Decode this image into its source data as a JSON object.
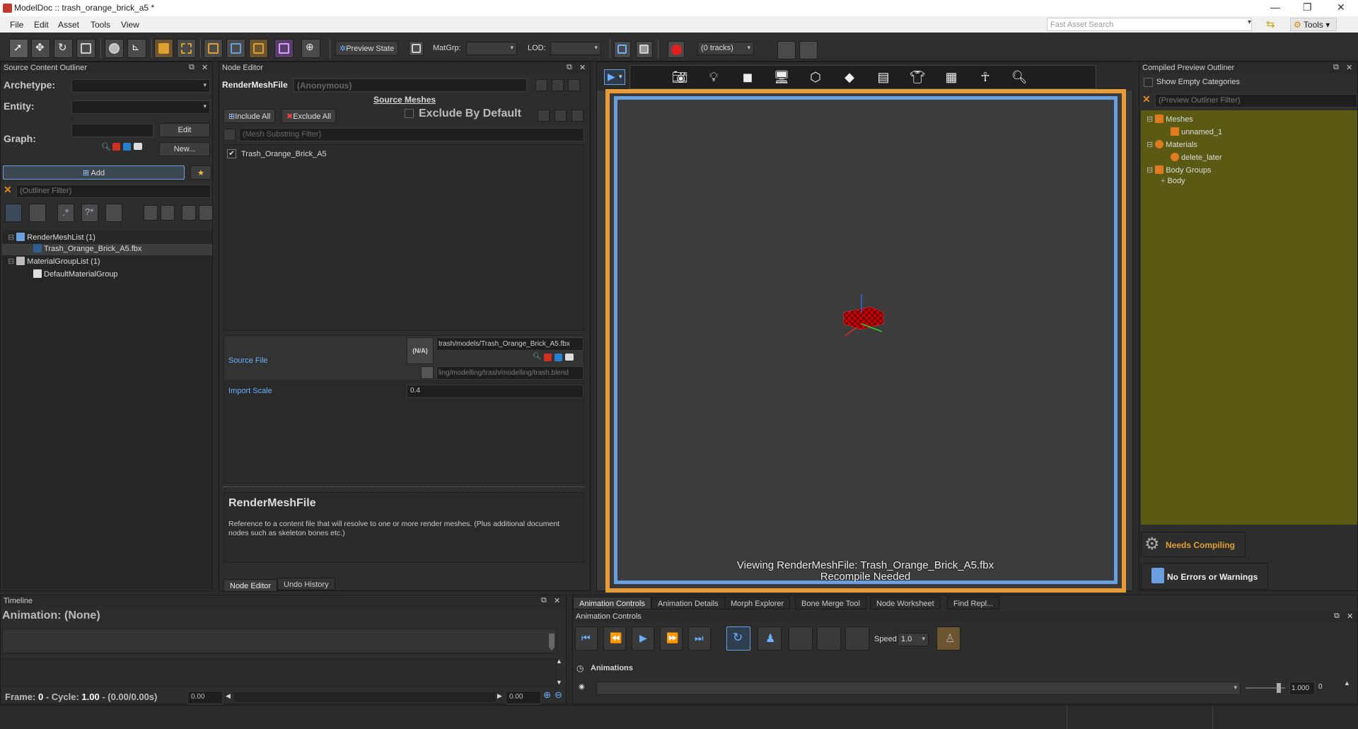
{
  "window": {
    "title": "ModelDoc :: trash_orange_brick_a5 *"
  },
  "menu": [
    "File",
    "Edit",
    "Asset",
    "Tools",
    "View"
  ],
  "fast_search": {
    "placeholder": "Fast Asset Search"
  },
  "tools_label": "Tools",
  "toolbar": {
    "preview_state": "Preview State",
    "matgrp_label": "MatGrp:",
    "matgrp_value": "",
    "lod_label": "LOD:",
    "lod_value": "",
    "tracks_value": "(0 tracks)"
  },
  "outliner": {
    "title": "Source Content Outliner",
    "archetype_label": "Archetype:",
    "entity_label": "Entity:",
    "graph_label": "Graph:",
    "edit_label": "Edit",
    "new_label": "New...",
    "add_label": "Add",
    "filter_placeholder": "(Outliner Filter)",
    "tree": [
      {
        "label": "RenderMeshList (1)"
      },
      {
        "label": "Trash_Orange_Brick_A5.fbx"
      },
      {
        "label": "MaterialGroupList (1)"
      },
      {
        "label": "DefaultMaterialGroup"
      }
    ]
  },
  "node_editor": {
    "title": "Node Editor",
    "node_type": "RenderMeshFile",
    "node_name": "(Anonymous)",
    "source_meshes": "Source Meshes",
    "include_all": "Include All",
    "exclude_all": "Exclude All",
    "exclude_by_default": "Exclude By Default",
    "mesh_filter_placeholder": "(Mesh Substring Filter)",
    "mesh_item": "Trash_Orange_Brick_A5",
    "source_file_label": "Source File",
    "na_label": "(N/A)",
    "source_file_value": "trash/models/Trash_Orange_Brick_A5.fbx",
    "blend_file_value": "ling/modelling/trash/modelling/trash.blend",
    "import_scale_label": "Import Scale",
    "import_scale_value": "0.4",
    "help_title": "RenderMeshFile",
    "help_text": "Reference to a content file that will resolve to one or more render meshes. (Plus additional document nodes such as skeleton bones etc.)",
    "tabs": [
      "Node Editor",
      "Undo History"
    ]
  },
  "viewport": {
    "status_line1": "Viewing RenderMeshFile: Trash_Orange_Brick_A5.fbx",
    "status_line2": "Recompile Needed"
  },
  "compiled_outliner": {
    "title": "Compiled Preview Outliner",
    "show_empty": "Show Empty Categories",
    "filter_placeholder": "(Preview Outliner Filter)",
    "tree": [
      {
        "label": "Meshes"
      },
      {
        "label": "unnamed_1"
      },
      {
        "label": "Materials"
      },
      {
        "label": "delete_later"
      },
      {
        "label": "Body Groups"
      },
      {
        "label": "Body"
      }
    ],
    "needs_compiling": "Needs Compiling",
    "no_errors": "No Errors or Warnings"
  },
  "timeline": {
    "title": "Timeline",
    "animation": "Animation: (None)",
    "frame_prefix": "Frame: ",
    "frame_value": "0",
    "cycle_prefix": " - Cycle: ",
    "cycle_value": "1.00",
    "time_range": " - (0.00/0.00s)",
    "start_value": "0.00",
    "end_value": "0.00"
  },
  "bottom_tabs": [
    "Animation Controls",
    "Animation Details",
    "Morph Explorer",
    "Bone Merge Tool",
    "Node Worksheet",
    "Find Repl..."
  ],
  "anim_controls": {
    "title": "Animation Controls",
    "speed_label": "Speed",
    "speed_value": "1.0",
    "animations_label": "Animations",
    "weight_value": "1.000",
    "weight_index": "0"
  },
  "colors": {
    "accent_orange": "#e79c3a",
    "accent_blue": "#6a9fe0",
    "outliner_bg": "#5b5a14"
  }
}
